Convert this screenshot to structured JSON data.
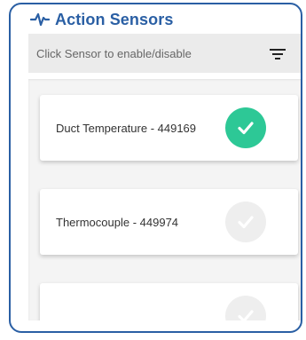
{
  "header": {
    "title": "Action Sensors",
    "icon": "pulse-icon",
    "accent_color": "#2a5fa4"
  },
  "filter": {
    "hint": "Click Sensor to enable/disable",
    "icon": "filter-icon"
  },
  "sensors": [
    {
      "label": "Duct Temperature - 449169",
      "enabled": true
    },
    {
      "label": "Thermocouple - 449974",
      "enabled": false
    },
    {
      "label": "",
      "enabled": false
    }
  ],
  "colors": {
    "enabled": "#2dc896",
    "disabled": "#eeeeee"
  }
}
